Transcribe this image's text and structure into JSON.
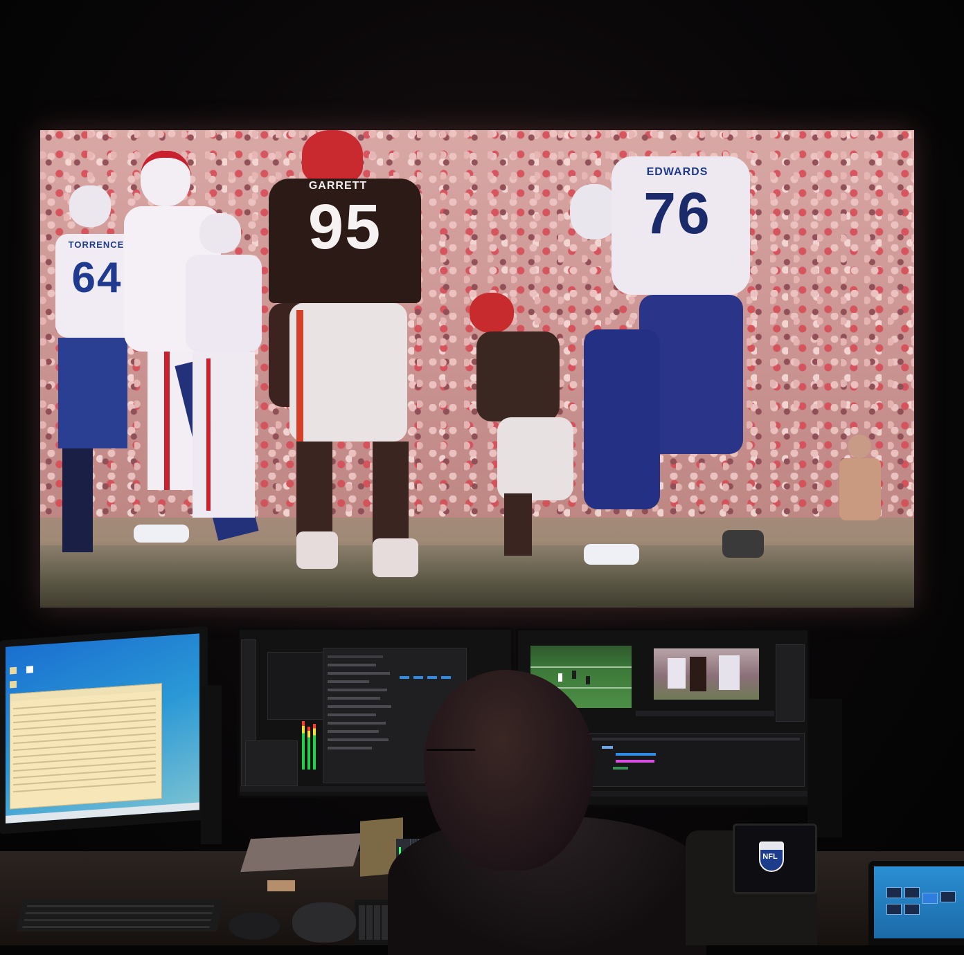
{
  "scene": {
    "players": [
      {
        "name_plate": "GARRETT",
        "number": "95"
      },
      {
        "name_plate": "EDWARDS",
        "number": "76"
      },
      {
        "name_plate": "TORRENCE",
        "number": "64"
      }
    ],
    "nfl_logo_text": "NFL"
  },
  "colors": {
    "bills_blue": "#1f3a8f",
    "bills_red": "#c8202f",
    "browns_brown": "#2c1a17",
    "browns_orange": "#d4412a",
    "timeline_blue": "#2e8be6",
    "timeline_pink": "#d64ee0"
  }
}
